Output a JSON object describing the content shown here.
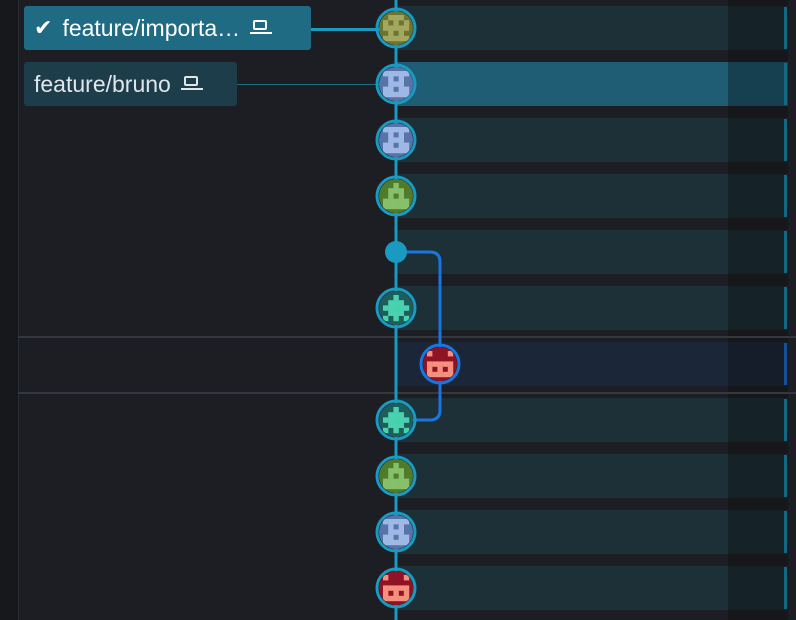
{
  "branches": [
    {
      "label": "feature/importa…",
      "checked_out": true,
      "local": true
    },
    {
      "label": "feature/bruno",
      "checked_out": false,
      "local": true
    }
  ],
  "colors": {
    "lane_main": "#1a9ac0",
    "lane_feature": "#1a75e0",
    "row_selected": "#1e5d73",
    "row_default": "#1d3038"
  },
  "commits": [
    {
      "avatar": "olive-pixel-avatar",
      "lane": "main"
    },
    {
      "avatar": "blue-pixel-avatar",
      "lane": "main",
      "selected": true
    },
    {
      "avatar": "blue-pixel-avatar",
      "lane": "main"
    },
    {
      "avatar": "green-pixel-avatar",
      "lane": "main"
    },
    {
      "avatar": "merge-dot",
      "lane": "main",
      "merge": true
    },
    {
      "avatar": "teal-pixel-avatar",
      "lane": "main"
    },
    {
      "avatar": "red-pixel-avatar",
      "lane": "feature"
    },
    {
      "avatar": "teal-pixel-avatar",
      "lane": "main"
    },
    {
      "avatar": "green-pixel-avatar",
      "lane": "main"
    },
    {
      "avatar": "blue-pixel-avatar",
      "lane": "main"
    },
    {
      "avatar": "red-pixel-avatar",
      "lane": "main"
    }
  ]
}
